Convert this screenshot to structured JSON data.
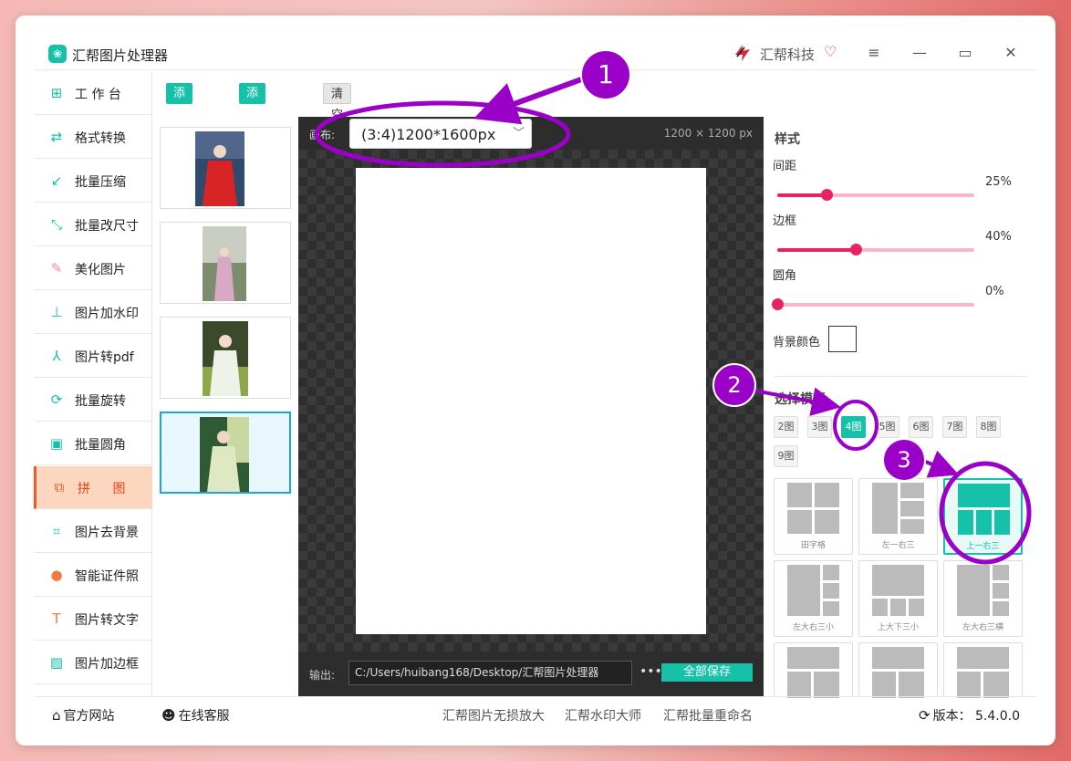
{
  "window": {
    "title": "汇帮图片处理器",
    "brand": "汇帮科技"
  },
  "toolbar": {
    "add_file": "添加文件",
    "add_folder": "添加文件夹",
    "clear_list": "清空列表"
  },
  "sidebar": {
    "items": [
      {
        "label": "工 作 台",
        "icon": "grid-icon",
        "glyph": "⊞"
      },
      {
        "label": "格式转换",
        "icon": "format-convert-icon",
        "glyph": "⇄"
      },
      {
        "label": "批量压缩",
        "icon": "compress-icon",
        "glyph": "↙"
      },
      {
        "label": "批量改尺寸",
        "icon": "resize-icon",
        "glyph": "⤡"
      },
      {
        "label": "美化图片",
        "icon": "beautify-icon",
        "glyph": "✎"
      },
      {
        "label": "图片加水印",
        "icon": "watermark-icon",
        "glyph": "⊥"
      },
      {
        "label": "图片转pdf",
        "icon": "pdf-icon",
        "glyph": "⅄"
      },
      {
        "label": "批量旋转",
        "icon": "rotate-icon",
        "glyph": "⟳"
      },
      {
        "label": "批量圆角",
        "icon": "round-corner-icon",
        "glyph": "▣"
      },
      {
        "label": "拼  图",
        "icon": "collage-icon",
        "glyph": "⧉"
      },
      {
        "label": "图片去背景",
        "icon": "crop-icon",
        "glyph": "⌗"
      },
      {
        "label": "智能证件照",
        "icon": "id-photo-icon",
        "glyph": "●"
      },
      {
        "label": "图片转文字",
        "icon": "text-icon",
        "glyph": "T"
      },
      {
        "label": "图片加边框",
        "icon": "frame-icon",
        "glyph": "▨"
      }
    ]
  },
  "preview": {
    "canvas_label": "画布:",
    "canvas_size": "(3:4)1200*1600px",
    "dimensions": "1200 × 1200 px",
    "output_label": "输出:",
    "output_path": "C:/Users/huibang168/Desktop/汇帮图片处理器",
    "more": "•••",
    "save_all": "全部保存"
  },
  "style_panel": {
    "title": "样式",
    "spacing": {
      "label": "间距",
      "value": "25%",
      "level": 0.25
    },
    "border": {
      "label": "边框",
      "value": "40%",
      "level": 0.4
    },
    "radius": {
      "label": "圆角",
      "value": "0%",
      "level": 0.0
    },
    "bg_color": {
      "label": "背景颜色",
      "color": "#ffffff"
    }
  },
  "templates": {
    "title": "选择模板",
    "counts": [
      "2图",
      "3图",
      "4图",
      "5图",
      "6图",
      "7图",
      "8图",
      "9图"
    ],
    "selected_count": "4图",
    "layouts": [
      "田字格",
      "左一右三",
      "上一右三",
      "左大右三小",
      "上大下三小",
      "左大右三横"
    ],
    "selected_layout": "上一右三"
  },
  "bottom": {
    "official_site": "官方网站",
    "online_service": "在线客服",
    "link1": "汇帮图片无损放大",
    "link2": "汇帮水印大师",
    "link3": "汇帮批量重命名",
    "version": "版本： 5.4.0.0"
  },
  "annotations": [
    "1",
    "2",
    "3"
  ],
  "colors": {
    "accent": "#16c1a9",
    "slider": "#e8245f",
    "annotation": "#9a00c8",
    "active_nav": "#e8431a"
  }
}
